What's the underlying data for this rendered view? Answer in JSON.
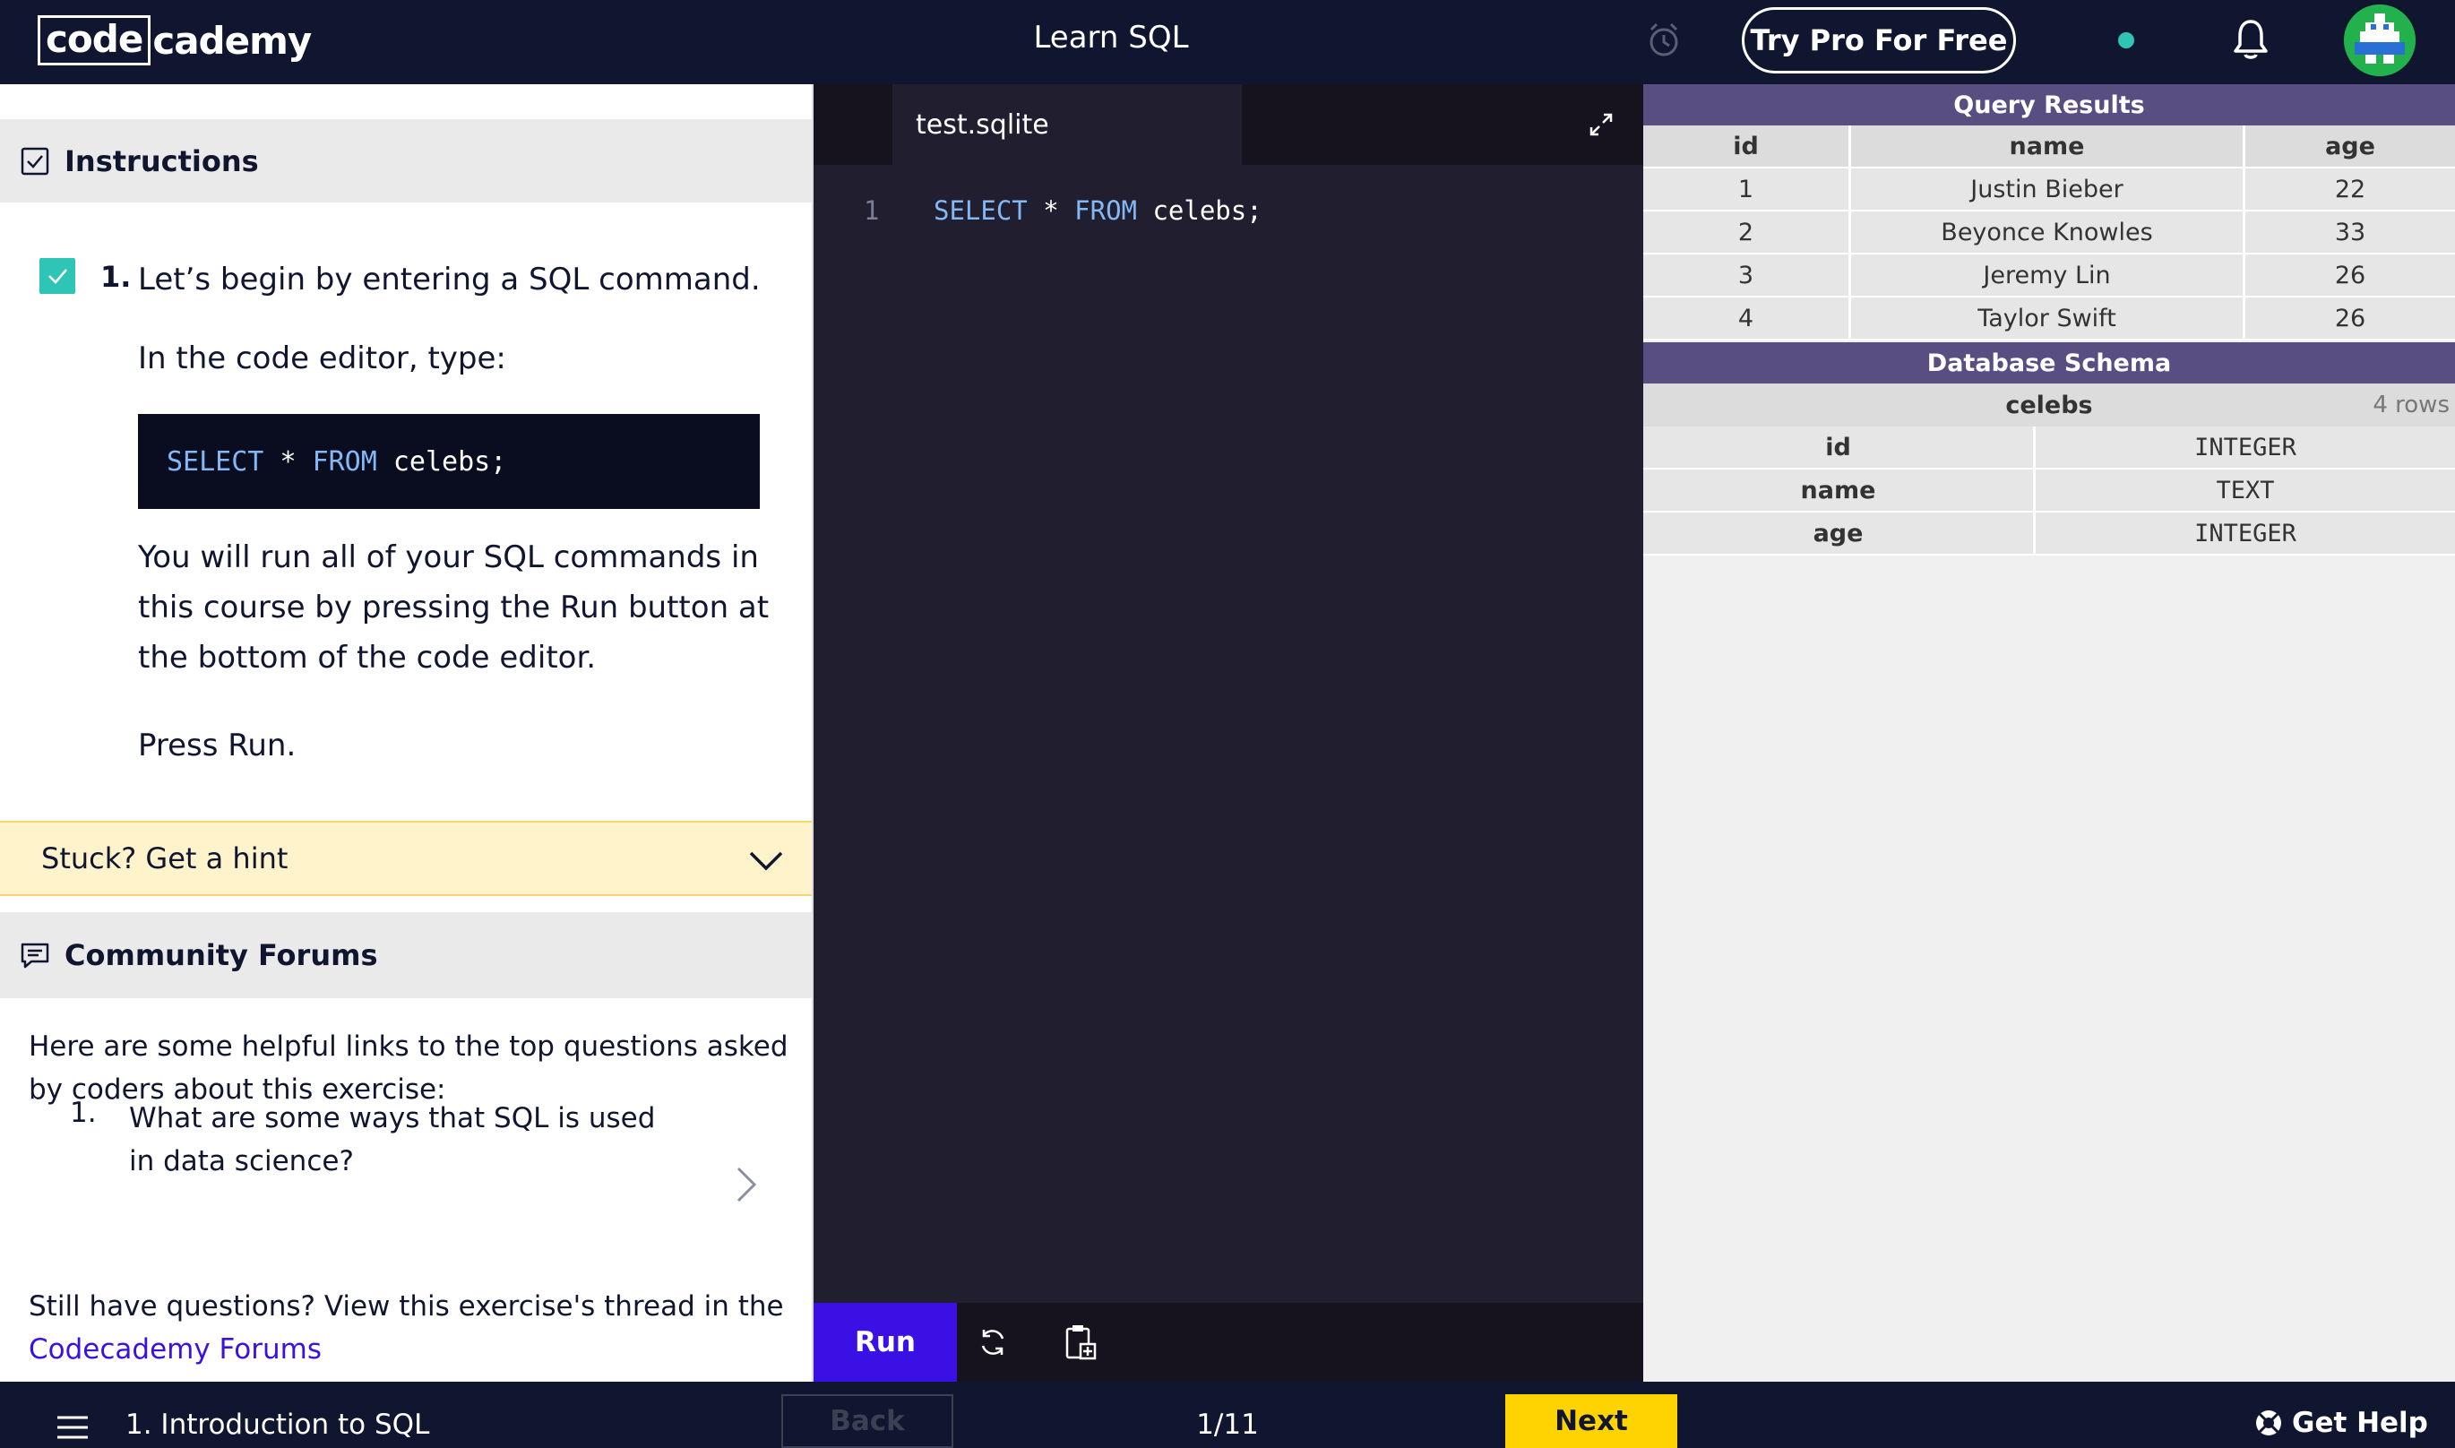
{
  "header": {
    "logo_boxed": "code",
    "logo_rest": "cademy",
    "title": "Learn SQL",
    "pro_button": "Try Pro For Free"
  },
  "instructions": {
    "heading": "Instructions",
    "task_number": "1.",
    "task_text": "Let’s begin by entering a SQL command.",
    "editor_hint": "In the code editor, type:",
    "code_select": "SELECT",
    "code_star": "*",
    "code_from": "FROM",
    "code_rest": "celebs;",
    "run_instruction": "You will run all of your SQL commands in this course by pressing the Run button at the bottom of the code editor.",
    "press_run": "Press Run.",
    "hint_label": "Stuck? Get a hint"
  },
  "forums": {
    "heading": "Community Forums",
    "intro": "Here are some helpful links to the top questions asked by coders about this exercise:",
    "question_number": "1.",
    "question": "What are some ways that SQL is used in data science?",
    "still_text": "Still have questions? View this exercise's thread in the",
    "link_text": "Codecademy Forums"
  },
  "editor": {
    "file_tab": "test.sqlite",
    "line_number": "1",
    "code_select": "SELECT",
    "code_star": " * ",
    "code_from": "FROM",
    "code_rest": " celebs;",
    "run_label": "Run"
  },
  "results": {
    "query_heading": "Query Results",
    "columns": [
      "id",
      "name",
      "age"
    ],
    "rows": [
      [
        "1",
        "Justin Bieber",
        "22"
      ],
      [
        "2",
        "Beyonce Knowles",
        "33"
      ],
      [
        "3",
        "Jeremy Lin",
        "26"
      ],
      [
        "4",
        "Taylor Swift",
        "26"
      ]
    ],
    "schema_heading": "Database Schema",
    "table_name": "celebs",
    "row_count": "4 rows",
    "schema": [
      [
        "id",
        "INTEGER"
      ],
      [
        "name",
        "TEXT"
      ],
      [
        "age",
        "INTEGER"
      ]
    ]
  },
  "footer": {
    "lesson": "1. Introduction to SQL",
    "back": "Back",
    "progress": "1/11",
    "next": "Next",
    "help": "Get Help"
  },
  "colors": {
    "nav": "#10162f",
    "accent": "#3a10e5",
    "next": "#ffd300",
    "check": "#2ec4b6",
    "results_header": "#584e82"
  }
}
